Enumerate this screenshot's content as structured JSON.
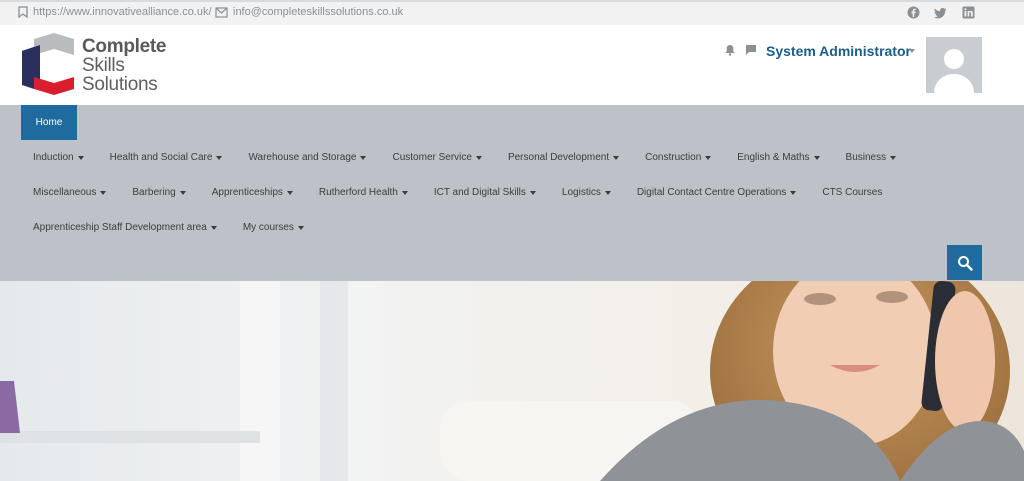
{
  "topbar": {
    "website": "https://www.innovativealliance.co.uk/",
    "email": "info@completeskillssolutions.co.uk"
  },
  "logo": {
    "line1": "Complete",
    "line2": "Skills",
    "line3": "Solutions"
  },
  "user": {
    "name": "System Administrator"
  },
  "nav": {
    "home": "Home",
    "row1": [
      "Induction",
      "Health and Social Care",
      "Warehouse and Storage",
      "Customer Service",
      "Personal Development",
      "Construction",
      "English & Maths",
      "Business"
    ],
    "row2": [
      "Miscellaneous",
      "Barbering",
      "Apprenticeships",
      "Rutherford Health",
      "ICT and Digital Skills",
      "Logistics",
      "Digital Contact Centre Operations",
      "CTS Courses"
    ],
    "row3": [
      "Apprenticeship Staff Development area",
      "My courses"
    ]
  },
  "colors": {
    "accent": "#1f6b9e",
    "nav_bg": "#bcc2c8",
    "logo_red": "#d91e2e",
    "logo_navy": "#2b2f5e"
  }
}
